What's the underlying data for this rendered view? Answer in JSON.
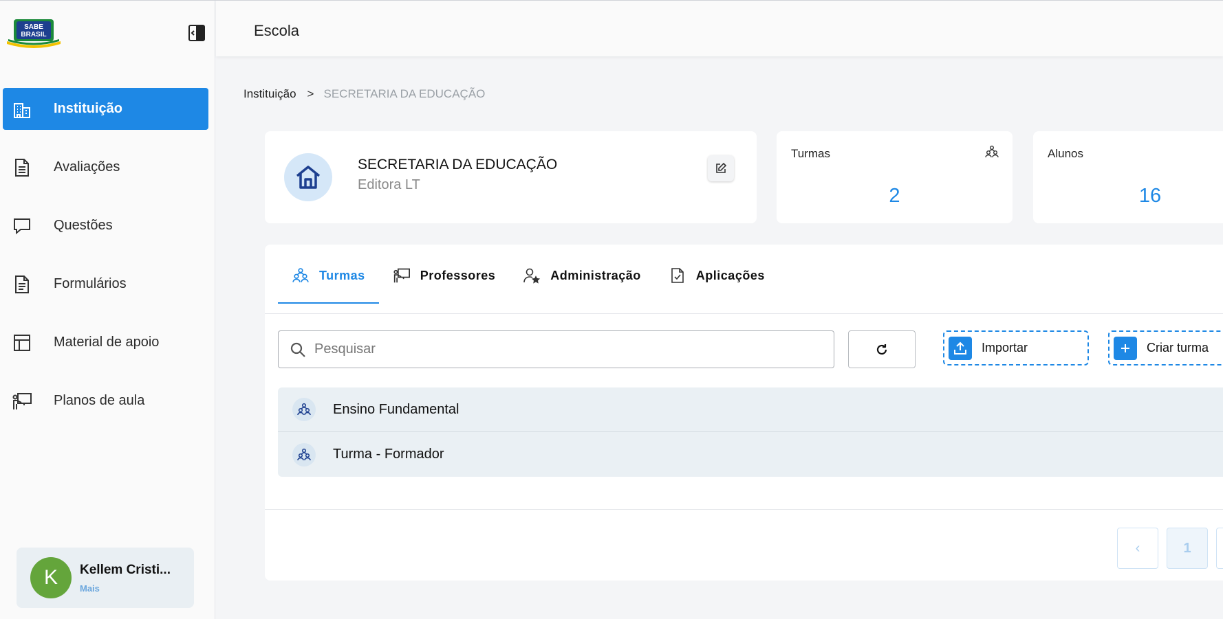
{
  "sidebar": {
    "logo_text_line1": "SABE",
    "logo_text_line2": "BRASIL",
    "items": [
      {
        "label": "Instituição",
        "icon": "building-icon",
        "active": true
      },
      {
        "label": "Avaliações",
        "icon": "document-icon"
      },
      {
        "label": "Questões",
        "icon": "chat-bubble-icon"
      },
      {
        "label": "Formulários",
        "icon": "form-icon"
      },
      {
        "label": "Material de apoio",
        "icon": "layout-icon"
      },
      {
        "label": "Planos de aula",
        "icon": "teacher-board-icon"
      }
    ],
    "user": {
      "initial": "K",
      "name": "Kellem Cristi...",
      "more": "Mais"
    }
  },
  "header": {
    "title": "Escola"
  },
  "breadcrumb": {
    "root": "Instituição",
    "separator": ">",
    "current": "SECRETARIA DA EDUCAÇÃO"
  },
  "org": {
    "name": "SECRETARIA DA EDUCAÇÃO",
    "subtitle": "Editora LT"
  },
  "stats": {
    "turmas": {
      "label": "Turmas",
      "value": "2"
    },
    "alunos": {
      "label": "Alunos",
      "value": "16"
    }
  },
  "tabs": [
    {
      "label": "Turmas",
      "active": true
    },
    {
      "label": "Professores"
    },
    {
      "label": "Administração"
    },
    {
      "label": "Aplicações"
    }
  ],
  "toolbar": {
    "search_placeholder": "Pesquisar",
    "import_label": "Importar",
    "create_label": "Criar turma"
  },
  "classes": [
    {
      "name": "Ensino Fundamental"
    },
    {
      "name": "Turma - Formador"
    }
  ],
  "pagination": {
    "current": "1",
    "prev": "‹"
  },
  "colors": {
    "accent": "#1e88e5",
    "avatar": "#64a53b",
    "row_bg": "#eaf0f4"
  }
}
